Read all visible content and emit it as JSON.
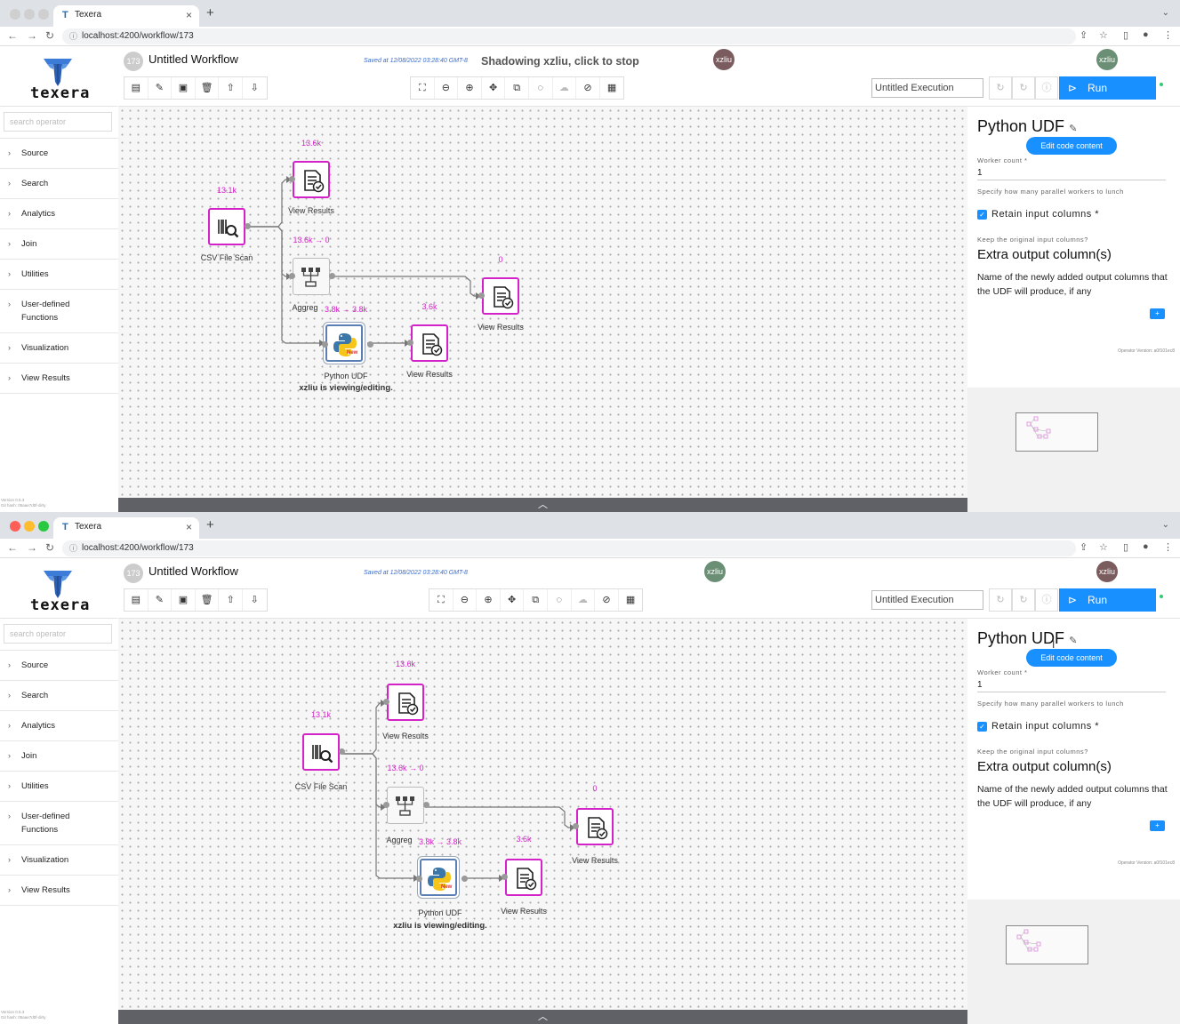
{
  "browser": {
    "tab_title": "Texera",
    "tab_icon": "T",
    "close_glyph": "×",
    "new_tab_glyph": "+",
    "tab_menu_glyph": "⌄",
    "url": "localhost:4200/workflow/173",
    "back_glyph": "←",
    "forward_glyph": "→",
    "reload_glyph": "↻",
    "lock_glyph": "ⓘ",
    "share_glyph": "⇪",
    "star_glyph": "☆",
    "sidepanel_glyph": "▯",
    "profile_glyph": "●",
    "menu_glyph": "⋮"
  },
  "app": {
    "logo_text": "texera",
    "workflow_number": "173",
    "workflow_name": "Untitled Workflow",
    "saved_text": "Saved at 12/08/2022 03:28:40 GMT-8",
    "shadowing_text": "Shadowing xzliu, click to stop",
    "user_initials": "xzliu",
    "execution_name": "Untitled Execution",
    "run_label": "Run",
    "run_icon": "⊳",
    "ctrl_icons": [
      "↻",
      "↻",
      "ⓘ"
    ]
  },
  "toolbar_left": [
    {
      "name": "list-icon",
      "glyph": "▤"
    },
    {
      "name": "edit-icon",
      "glyph": "✎"
    },
    {
      "name": "save-icon",
      "glyph": "▣"
    },
    {
      "name": "delete-icon",
      "glyph": "🗑"
    },
    {
      "name": "export-icon",
      "glyph": "⇧"
    },
    {
      "name": "download-icon",
      "glyph": "⇩"
    }
  ],
  "toolbar_center": [
    {
      "name": "fit-icon",
      "glyph": "⛶",
      "enabled": true
    },
    {
      "name": "zoom-out-icon",
      "glyph": "⊖",
      "enabled": true
    },
    {
      "name": "zoom-in-icon",
      "glyph": "⊕",
      "enabled": true
    },
    {
      "name": "expand-icon",
      "glyph": "✥",
      "enabled": true
    },
    {
      "name": "layout-icon",
      "glyph": "⧉",
      "enabled": true
    },
    {
      "name": "comment-icon",
      "glyph": "◌",
      "enabled": true
    },
    {
      "name": "upload-icon",
      "glyph": "☁",
      "enabled": false
    },
    {
      "name": "disable-icon",
      "glyph": "⊘",
      "enabled": true
    },
    {
      "name": "table-icon",
      "glyph": "▦",
      "enabled": true
    }
  ],
  "sidebar": {
    "search_placeholder": "search operator",
    "chevron": "›",
    "categories": [
      "Source",
      "Search",
      "Analytics",
      "Join",
      "Utilities",
      "User-defined Functions",
      "Visualization",
      "View Results"
    ],
    "version_line1": "Version 0.5.3",
    "version_line2": "Git hash: 05aae7d0f-dirty"
  },
  "panel": {
    "title": "Python UDF",
    "title_icon": "✎",
    "edit_button": "Edit code content",
    "worker_label": "Worker count *",
    "worker_value": "1",
    "worker_hint": "Specify how many parallel workers to lunch",
    "check_glyph": "✓",
    "retain_label": "Retain input columns *",
    "keep_hint": "Keep the original input columns?",
    "extra_title": "Extra output column(s)",
    "extra_desc": "Name of the newly added output columns that the UDF will produce, if any",
    "add_glyph": "+",
    "operator_version": "Operator Version: a0f101ec8"
  },
  "operators": {
    "csv_label": "CSV File Scan",
    "csv_count": "13.1k",
    "view1_label": "View Results",
    "view1_count": "13.6k",
    "agg_label": "Aggreg",
    "agg_in_count": "13.6k → 0",
    "agg_out_count": "3.8k → 3.8k",
    "view2_label": "View Results",
    "view2_count": "0",
    "python_label": "Python UDF",
    "python_badge": "New",
    "python_note": "xzliu is viewing/editing.",
    "view3_label": "View Results",
    "view3_count": "3.6k"
  },
  "bottom_toggle": "︿",
  "colors": {
    "accent": "#1890ff",
    "operator_border": "#d323c8",
    "avatar_shadow": "#7a5b5e",
    "avatar_owner": "#6b8f74"
  }
}
